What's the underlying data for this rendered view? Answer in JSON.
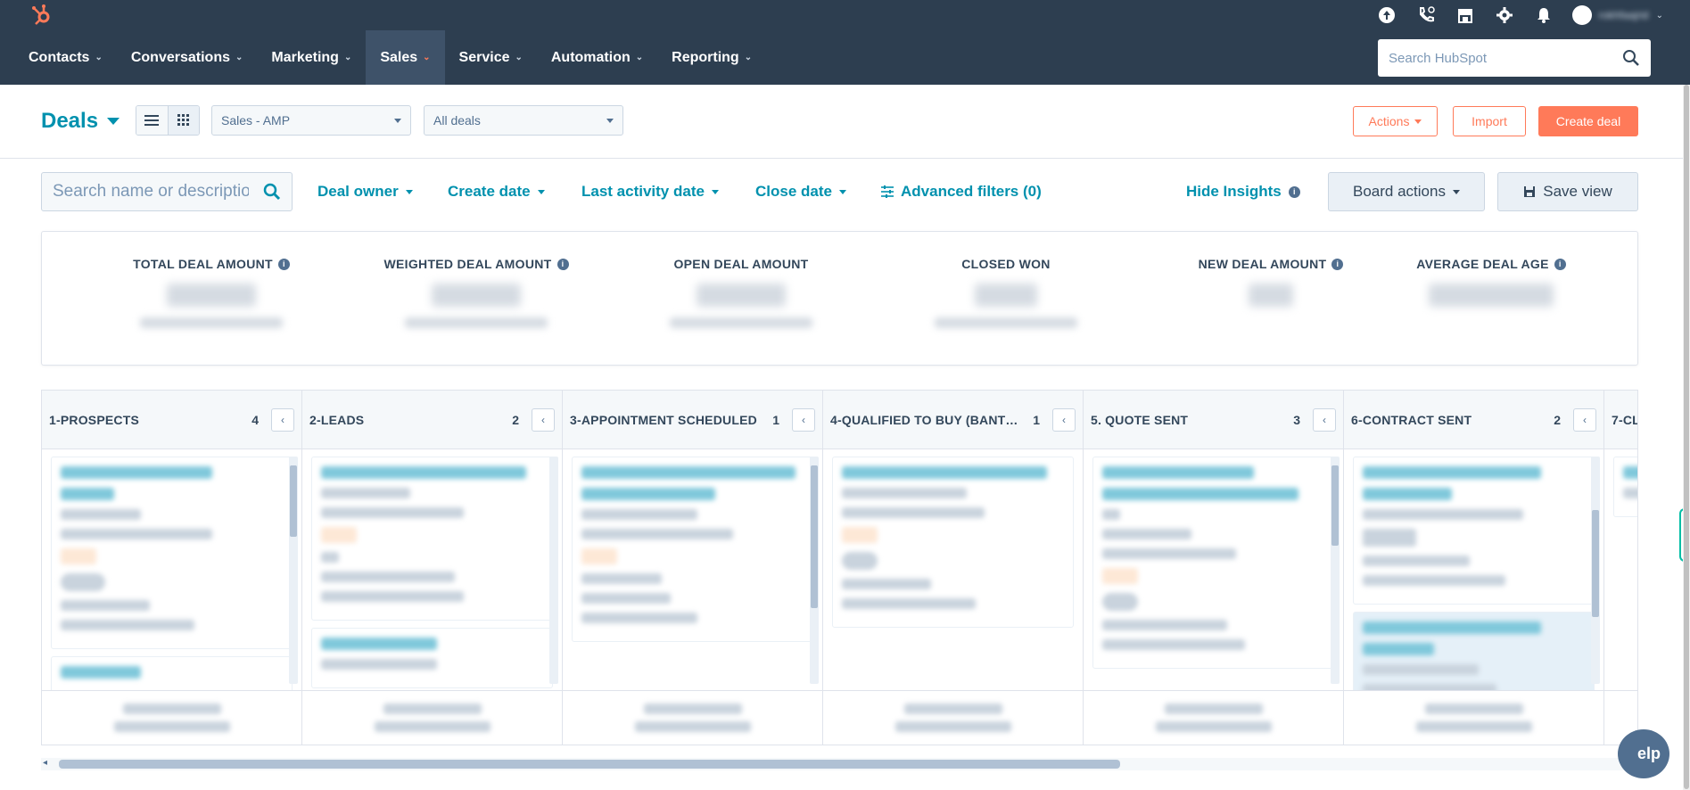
{
  "topbar": {
    "account_name": "rokhfaajrid"
  },
  "nav": {
    "items": [
      {
        "label": "Contacts"
      },
      {
        "label": "Conversations"
      },
      {
        "label": "Marketing"
      },
      {
        "label": "Sales"
      },
      {
        "label": "Service"
      },
      {
        "label": "Automation"
      },
      {
        "label": "Reporting"
      }
    ],
    "search_placeholder": "Search HubSpot"
  },
  "header": {
    "title": "Deals",
    "pipeline": "Sales - AMP",
    "view": "All deals",
    "actions_label": "Actions",
    "import_label": "Import",
    "create_label": "Create deal"
  },
  "filters": {
    "search_placeholder": "Search name or descriptio",
    "deal_owner": "Deal owner",
    "create_date": "Create date",
    "last_activity_date": "Last activity date",
    "close_date": "Close date",
    "advanced": "Advanced filters (0)",
    "hide_insights": "Hide Insights",
    "board_actions": "Board actions",
    "save_view": "Save view"
  },
  "insights": [
    {
      "label": "TOTAL DEAL AMOUNT",
      "info": true
    },
    {
      "label": "WEIGHTED DEAL AMOUNT",
      "info": true
    },
    {
      "label": "OPEN DEAL AMOUNT",
      "info": false
    },
    {
      "label": "CLOSED WON",
      "info": false
    },
    {
      "label": "NEW DEAL AMOUNT",
      "info": true
    },
    {
      "label": "AVERAGE DEAL AGE",
      "info": true
    }
  ],
  "columns": [
    {
      "name": "1-PROSPECTS",
      "count": "4"
    },
    {
      "name": "2-LEADS",
      "count": "2"
    },
    {
      "name": "3-APPOINTMENT SCHEDULED",
      "count": "1"
    },
    {
      "name": "4-QUALIFIED TO BUY (BANT…",
      "count": "1"
    },
    {
      "name": "5. QUOTE SENT",
      "count": "3"
    },
    {
      "name": "6-CONTRACT SENT",
      "count": "2"
    },
    {
      "name": "7-CL",
      "count": ""
    }
  ],
  "help_label": "elp",
  "colors": {
    "nav_bg": "#2d3e50",
    "accent": "#ff7a59",
    "link": "#0091ae"
  }
}
